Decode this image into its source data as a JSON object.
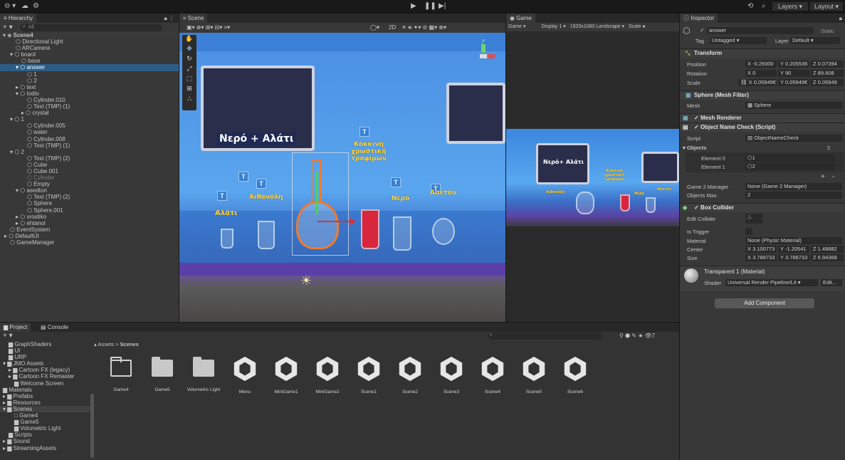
{
  "toolbar": {
    "layers": "Layers",
    "layout": "Layout"
  },
  "hierarchy": {
    "tab": "Hierarchy",
    "search_placeholder": "All",
    "items": [
      {
        "label": "Scene4"
      },
      {
        "label": "Directional Light"
      },
      {
        "label": "ARCamera"
      },
      {
        "label": "board"
      },
      {
        "label": "base"
      },
      {
        "label": "answer"
      },
      {
        "label": "1"
      },
      {
        "label": "2"
      },
      {
        "label": "text"
      },
      {
        "label": "Iodio"
      },
      {
        "label": "Cylinder.010"
      },
      {
        "label": "Text (TMP) (1)"
      },
      {
        "label": "crystal"
      },
      {
        "label": "1"
      },
      {
        "label": "Cylinder.005"
      },
      {
        "label": "water"
      },
      {
        "label": "Cylinder.008"
      },
      {
        "label": "Text (TMP) (1)"
      },
      {
        "label": "2"
      },
      {
        "label": "Text (TMP) (2)"
      },
      {
        "label": "Cube"
      },
      {
        "label": "Cube.001"
      },
      {
        "label": "Cylinder"
      },
      {
        "label": "Empty"
      },
      {
        "label": "asedton"
      },
      {
        "label": "Text (TMP) (2)"
      },
      {
        "label": "Sphere"
      },
      {
        "label": "Sphere.001"
      },
      {
        "label": "xrostiko"
      },
      {
        "label": "ehtanol"
      },
      {
        "label": "EventSystem"
      },
      {
        "label": "DefaultUI"
      },
      {
        "label": "GameManager"
      }
    ]
  },
  "scene": {
    "tab": "Scene",
    "toolbar_2d": "2D",
    "board_text": "Νερό + Αλάτι",
    "label_red": "Κόκκινη χρωστική τροφίμων",
    "label_ether": "Αιθανόλη",
    "label_water": "Νερό",
    "label_aceton": "Ασετόν",
    "label_salt": "Αλάτι",
    "label_t": "T",
    "axis_y": "y"
  },
  "game": {
    "tab": "Game",
    "mode": "Game",
    "display": "Display 1",
    "resolution": "1920x1080 Landscape",
    "scale": "Scale",
    "board_text": "Νερό+ Αλάτι",
    "label_red": "Κόκκινη χρωστική τροφίμων",
    "label_ether": "Αιθανόλη",
    "label_water": "Νερό",
    "label_aceton": "Ασετόν"
  },
  "inspector": {
    "tab": "Inspector",
    "object_name": "answer",
    "static": "Static",
    "tag_label": "Tag",
    "tag_value": "Untagged",
    "layer_label": "Layer",
    "layer_value": "Default",
    "transform": {
      "title": "Transform",
      "position": {
        "label": "Position",
        "x": "-0.29300",
        "y": "0.205536",
        "z": "0.07394"
      },
      "rotation": {
        "label": "Rotation",
        "x": "0",
        "y": "90",
        "z": "89.608"
      },
      "scale": {
        "label": "Scale",
        "x": "0.05949€",
        "y": "0.05949€",
        "z": "0.05949"
      }
    },
    "mesh_filter": {
      "title": "Sphere (Mesh Filter)",
      "mesh_label": "Mesh",
      "mesh_value": "Sphere"
    },
    "mesh_renderer": {
      "title": "Mesh Renderer"
    },
    "script_comp": {
      "title": "Object Name Check (Script)",
      "script_label": "Script",
      "script_value": "ObjectNameCheck",
      "objects_label": "Objects",
      "objects_count": "2",
      "elements": [
        {
          "label": "Element 0",
          "value": "1"
        },
        {
          "label": "Element 1",
          "value": "2"
        }
      ],
      "plus": "+",
      "minus": "-",
      "gm_label": "Game 2 Manager",
      "gm_value": "None (Game 2 Manager)",
      "omax_label": "Objects Max",
      "omax_value": "2"
    },
    "box_collider": {
      "title": "Box Collider",
      "edit_label": "Edit Collider",
      "trigger_label": "Is Trigger",
      "material_label": "Material",
      "material_value": "None (Physic Material)",
      "center": {
        "label": "Center",
        "x": "3.100773",
        "y": "-1.20541",
        "z": "1.48882"
      },
      "size": {
        "label": "Size",
        "x": "3.788733",
        "y": "3.788733",
        "z": "6.94368"
      }
    },
    "material": {
      "title": "Transparent 1 (Material)",
      "shader_label": "Shader",
      "shader_value": "Universal Render Pipeline/Lit",
      "edit": "Edit..."
    },
    "add_component": "Add Component"
  },
  "project": {
    "tab_project": "Project",
    "tab_console": "Console",
    "breadcrumb_root": "Assets",
    "breadcrumb_sep": ">",
    "breadcrumb_cur": "Scenes",
    "hidden_count": "7",
    "tree": [
      {
        "label": "GraphShaders"
      },
      {
        "label": "UI"
      },
      {
        "label": "URP"
      },
      {
        "label": "JMO Assets"
      },
      {
        "label": "Cartoon FX (legacy)"
      },
      {
        "label": "Cartoon FX Remaster"
      },
      {
        "label": "Welcome Screen"
      },
      {
        "label": "Materials"
      },
      {
        "label": "Prefabs"
      },
      {
        "label": "Resources"
      },
      {
        "label": "Scenes"
      },
      {
        "label": "Game4"
      },
      {
        "label": "Game5"
      },
      {
        "label": "Volumetric Light"
      },
      {
        "label": "Scripts"
      },
      {
        "label": "Sound"
      },
      {
        "label": "StreamingAssets"
      }
    ],
    "assets": [
      {
        "label": "Game4",
        "kind": "folder-outline"
      },
      {
        "label": "Game5",
        "kind": "folder"
      },
      {
        "label": "Volumetric Light",
        "kind": "folder"
      },
      {
        "label": "Menu",
        "kind": "scene"
      },
      {
        "label": "MiniGame1",
        "kind": "scene"
      },
      {
        "label": "MiniGame2",
        "kind": "scene"
      },
      {
        "label": "Scene1",
        "kind": "scene"
      },
      {
        "label": "Scene2",
        "kind": "scene"
      },
      {
        "label": "Scene3",
        "kind": "scene"
      },
      {
        "label": "Scene4",
        "kind": "scene"
      },
      {
        "label": "Scene5",
        "kind": "scene"
      },
      {
        "label": "Scene6",
        "kind": "scene"
      }
    ]
  }
}
